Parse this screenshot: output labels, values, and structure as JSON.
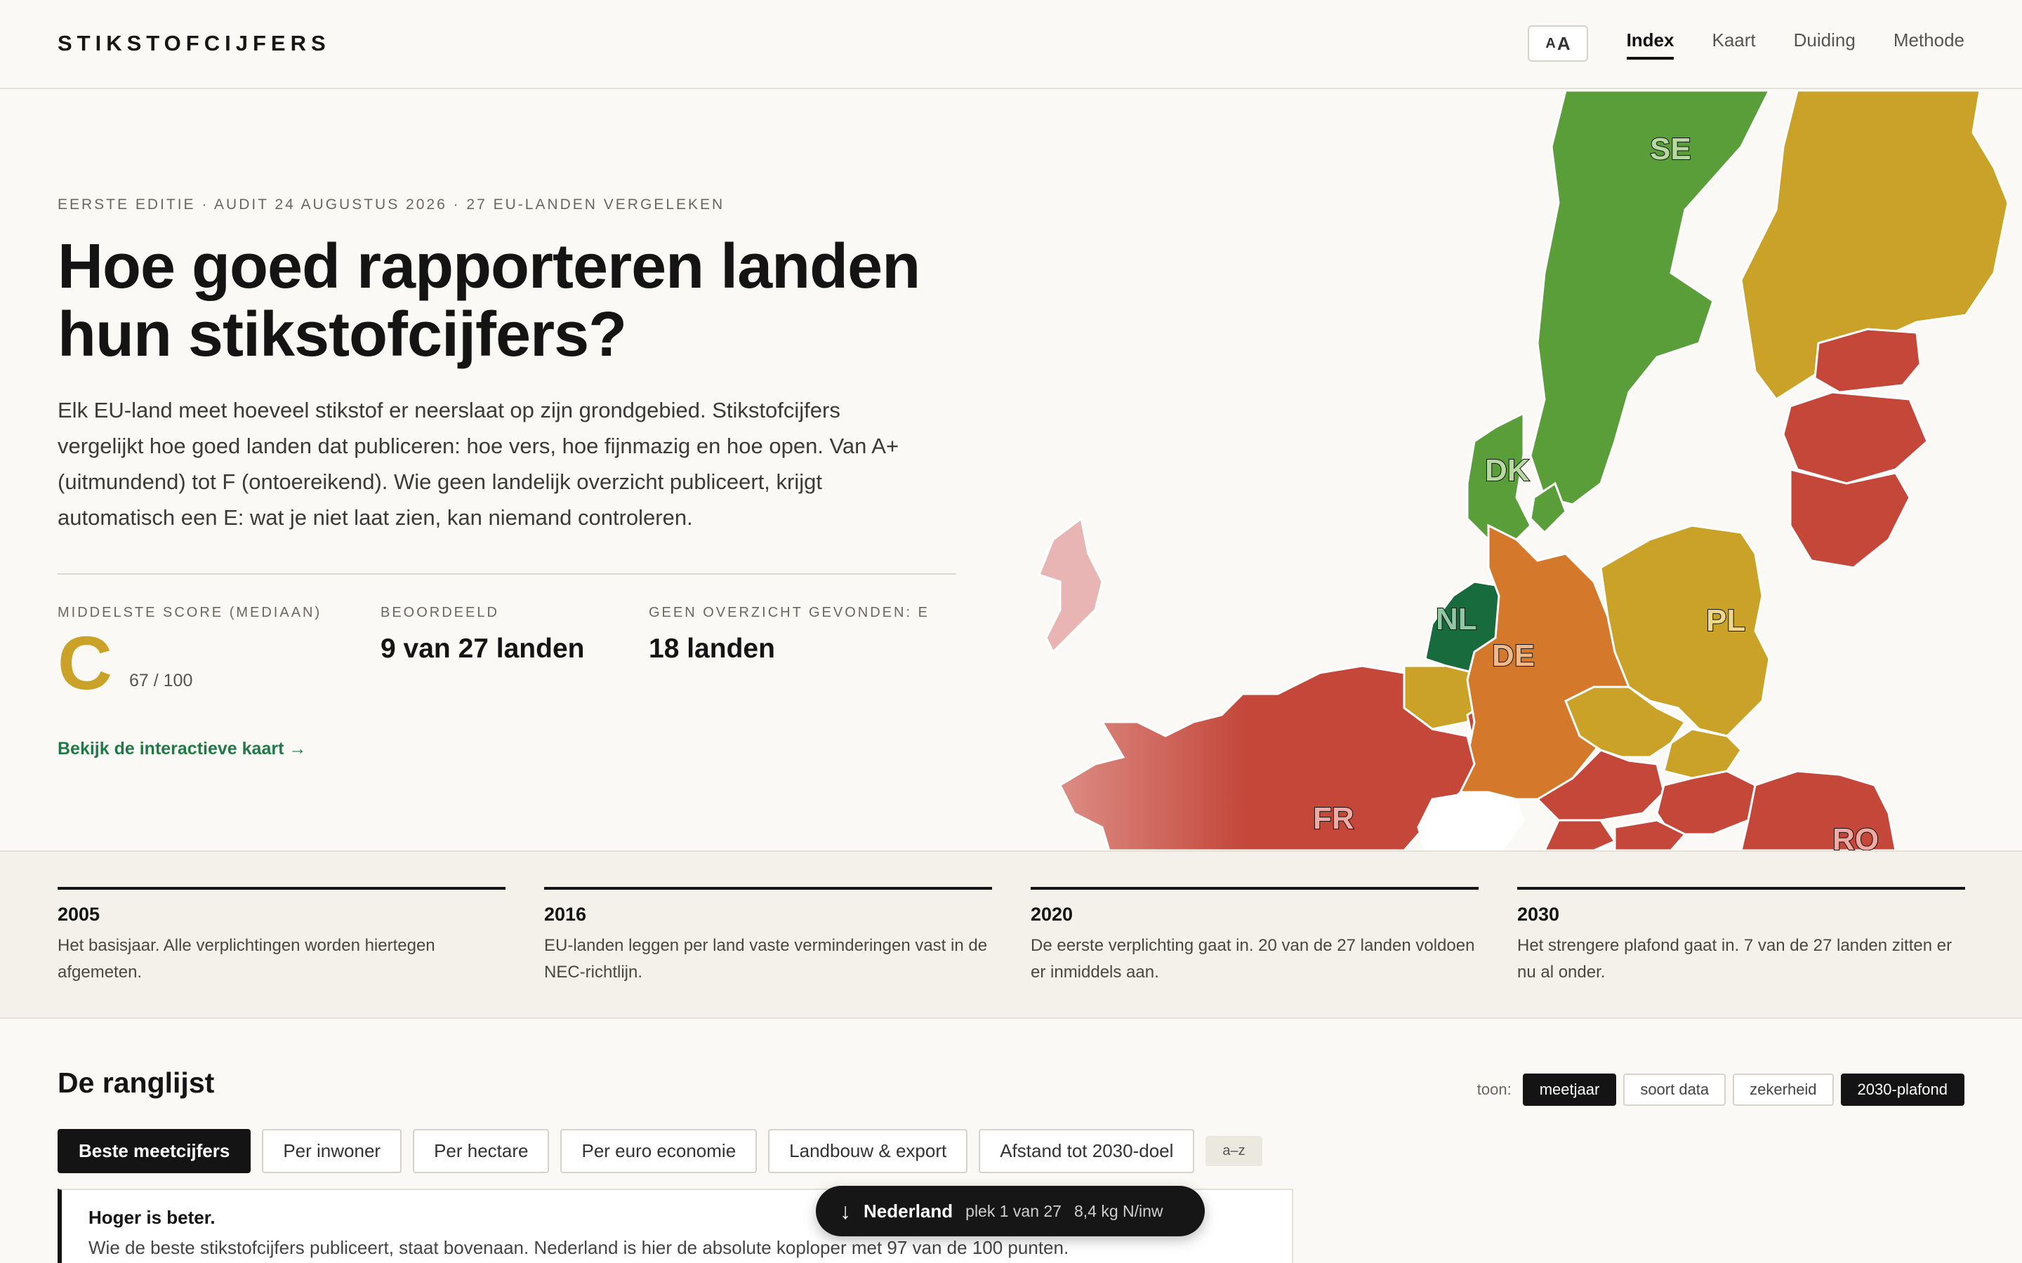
{
  "header": {
    "brand": "STIKSTOFCIJFERS",
    "aa_small": "A",
    "aa_large": "A",
    "nav": [
      {
        "label": "Index",
        "active": true
      },
      {
        "label": "Kaart",
        "active": false
      },
      {
        "label": "Duiding",
        "active": false
      },
      {
        "label": "Methode",
        "active": false
      }
    ]
  },
  "hero": {
    "eyebrow": "EERSTE EDITIE · AUDIT 24 AUGUSTUS 2026 · 27 EU-LANDEN VERGELEKEN",
    "title": "Hoe goed rapporteren landen hun stikstofcijfers?",
    "lead": "Elk EU-land meet hoeveel stikstof er neerslaat op zijn grondgebied. Stikstofcijfers vergelijkt hoe goed landen dat publiceren: hoe vers, hoe fijnmazig en hoe open. Van A+ (uitmundend) tot F (ontoereikend). Wie geen landelijk overzicht publiceert, krijgt automatisch een E: wat je niet laat zien, kan niemand controleren.",
    "stats": {
      "median_label": "MIDDELSTE SCORE (MEDIAAN)",
      "median_grade": "C",
      "median_score": "67 / 100",
      "rated_label": "BEOORDEELD",
      "rated_value": "9 van 27 landen",
      "none_label": "GEEN OVERZICHT GEVONDEN: E",
      "none_value": "18 landen"
    },
    "map_link": "Bekijk de interactieve kaart →"
  },
  "map": {
    "labels": [
      "SE",
      "DK",
      "NL",
      "DE",
      "PL",
      "FR",
      "RO"
    ],
    "colors": {
      "green": "#5a9e3a",
      "dark_green": "#176b3c",
      "yellow": "#c9a227",
      "orange": "#d4782b",
      "red": "#c4473a",
      "pink": "#e9b4b4"
    }
  },
  "timeline": [
    {
      "year": "2005",
      "text": "Het basisjaar. Alle verplichtingen worden hiertegen afgemeten."
    },
    {
      "year": "2016",
      "text": "EU-landen leggen per land vaste verminderingen vast in de NEC-richtlijn."
    },
    {
      "year": "2020",
      "text": "De eerste verplichting gaat in. 20 van de 27 landen voldoen er inmiddels aan."
    },
    {
      "year": "2030",
      "text": "Het strengere plafond gaat in. 7 van de 27 landen zitten er nu al onder."
    }
  ],
  "ranking": {
    "title": "De ranglijst",
    "toon_label": "toon:",
    "toon_chips": [
      {
        "label": "meetjaar",
        "on": true
      },
      {
        "label": "soort data",
        "on": false
      },
      {
        "label": "zekerheid",
        "on": false
      },
      {
        "label": "2030-plafond",
        "on": true
      }
    ],
    "tabs": [
      {
        "label": "Beste meetcijfers",
        "on": true
      },
      {
        "label": "Per inwoner",
        "on": false
      },
      {
        "label": "Per hectare",
        "on": false
      },
      {
        "label": "Per euro economie",
        "on": false
      },
      {
        "label": "Landbouw & export",
        "on": false
      },
      {
        "label": "Afstand tot 2030-doel",
        "on": false
      }
    ],
    "sort_label": "a–z",
    "note_heading": "Hoger is beter.",
    "note_text": "Wie de beste stikstofcijfers publiceert, staat bovenaan. Nederland is hier de absolute koploper met 97 van de 100 punten."
  },
  "pill": {
    "arrow": "↓",
    "country": "Nederland",
    "place": "plek 1 van 27",
    "value": "8,4 kg N/inw"
  }
}
